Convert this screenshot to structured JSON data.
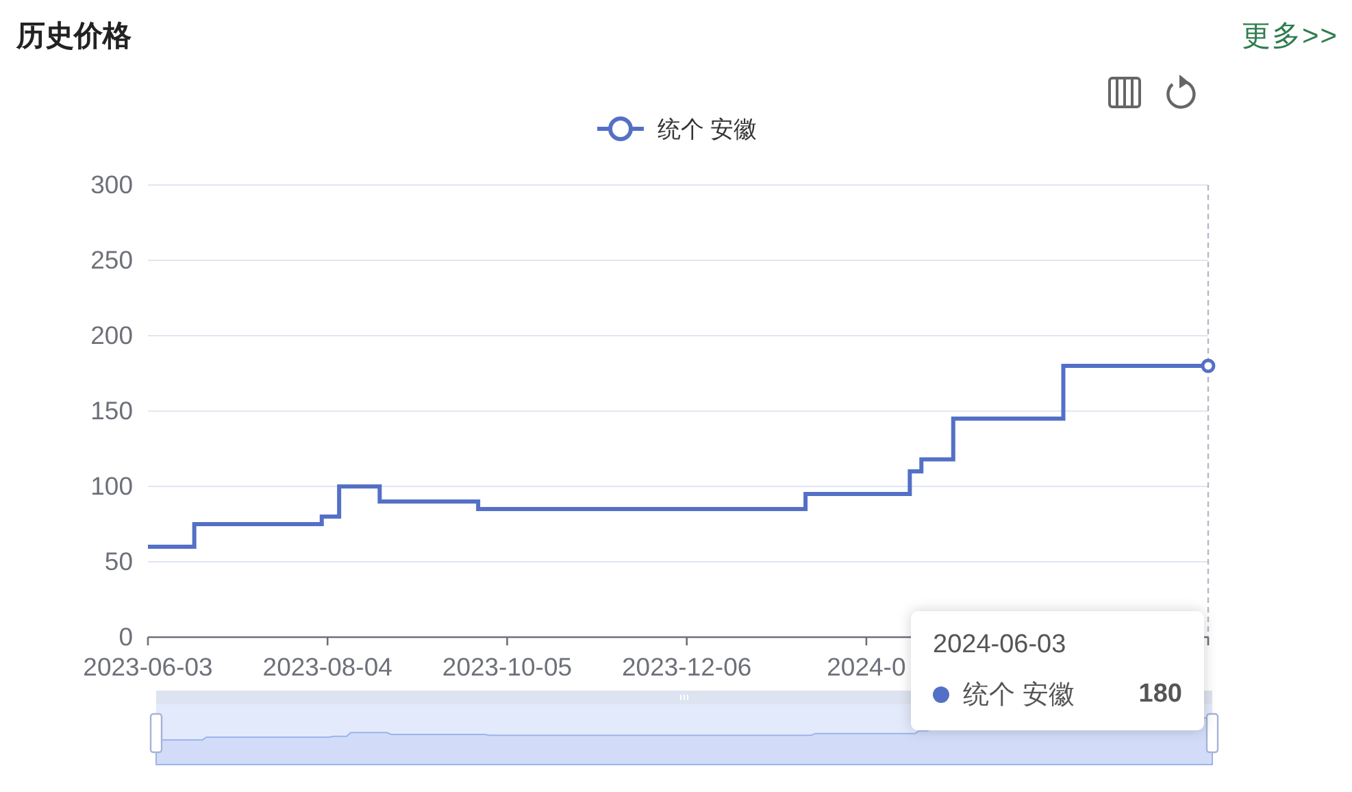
{
  "header": {
    "title": "历史价格",
    "more_link": "更多>>"
  },
  "chart": {
    "chart_data": {
      "type": "line",
      "grid": true,
      "x": [
        "2023-06-03",
        "2023-06-19",
        "2023-06-19",
        "2023-08-02",
        "2023-08-02",
        "2023-08-08",
        "2023-08-08",
        "2023-08-22",
        "2023-08-22",
        "2023-09-25",
        "2023-09-25",
        "2024-01-16",
        "2024-01-16",
        "2024-02-21",
        "2024-02-21",
        "2024-02-25",
        "2024-02-25",
        "2024-03-07",
        "2024-03-07",
        "2024-04-14",
        "2024-04-14",
        "2024-06-03"
      ],
      "series": [
        {
          "name": "统个 安徽",
          "color": "#5470c6",
          "values": [
            60,
            60,
            75,
            75,
            80,
            80,
            100,
            100,
            90,
            90,
            85,
            85,
            95,
            95,
            110,
            110,
            118,
            118,
            145,
            145,
            180,
            180
          ]
        }
      ],
      "xlim": [
        "2023-06-03",
        "2024-06-03"
      ],
      "ylim": [
        0,
        300
      ],
      "yticks": [
        0,
        50,
        100,
        150,
        200,
        250,
        300
      ],
      "xticks": [
        {
          "value": "2023-06-03",
          "label": "2023-06-03"
        },
        {
          "value": "2023-08-04",
          "label": "2023-08-04"
        },
        {
          "value": "2023-10-05",
          "label": "2023-10-05"
        },
        {
          "value": "2023-12-06",
          "label": "2023-12-06"
        },
        {
          "value": "2024-02-06",
          "label": "2024-0"
        }
      ]
    },
    "tooltip": {
      "date": "2024-06-03",
      "series_name": "统个 安徽",
      "value": "180"
    }
  }
}
